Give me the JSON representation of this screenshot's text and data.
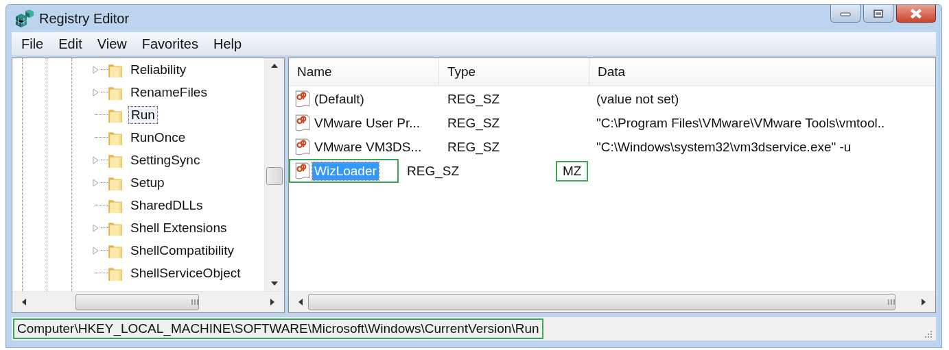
{
  "window": {
    "title": "Registry Editor"
  },
  "menu": [
    "File",
    "Edit",
    "View",
    "Favorites",
    "Help"
  ],
  "tree": {
    "items": [
      {
        "label": "Reliability",
        "expandable": true,
        "selected": false
      },
      {
        "label": "RenameFiles",
        "expandable": true,
        "selected": false
      },
      {
        "label": "Run",
        "expandable": false,
        "selected": true
      },
      {
        "label": "RunOnce",
        "expandable": false,
        "selected": false
      },
      {
        "label": "SettingSync",
        "expandable": true,
        "selected": false
      },
      {
        "label": "Setup",
        "expandable": true,
        "selected": false
      },
      {
        "label": "SharedDLLs",
        "expandable": false,
        "selected": false
      },
      {
        "label": "Shell Extensions",
        "expandable": true,
        "selected": false
      },
      {
        "label": "ShellCompatibility",
        "expandable": true,
        "selected": false
      },
      {
        "label": "ShellServiceObject",
        "expandable": false,
        "selected": false
      }
    ]
  },
  "table": {
    "columns": [
      "Name",
      "Type",
      "Data"
    ],
    "rows": [
      {
        "name": "(Default)",
        "type": "REG_SZ",
        "data": "(value not set)",
        "selected": false,
        "name_outlined": false,
        "data_outlined": false
      },
      {
        "name": "VMware User Pr...",
        "type": "REG_SZ",
        "data": "\"C:\\Program Files\\VMware\\VMware Tools\\vmtool..",
        "selected": false,
        "name_outlined": false,
        "data_outlined": false
      },
      {
        "name": "VMware VM3DS...",
        "type": "REG_SZ",
        "data": "\"C:\\Windows\\system32\\vm3dservice.exe\" -u",
        "selected": false,
        "name_outlined": false,
        "data_outlined": false
      },
      {
        "name": "WizLoader",
        "type": "REG_SZ",
        "data": "MZ",
        "selected": true,
        "name_outlined": true,
        "data_outlined": true
      }
    ]
  },
  "status_bar": {
    "path": "Computer\\HKEY_LOCAL_MACHINE\\SOFTWARE\\Microsoft\\Windows\\CurrentVersion\\Run",
    "outlined": true
  }
}
